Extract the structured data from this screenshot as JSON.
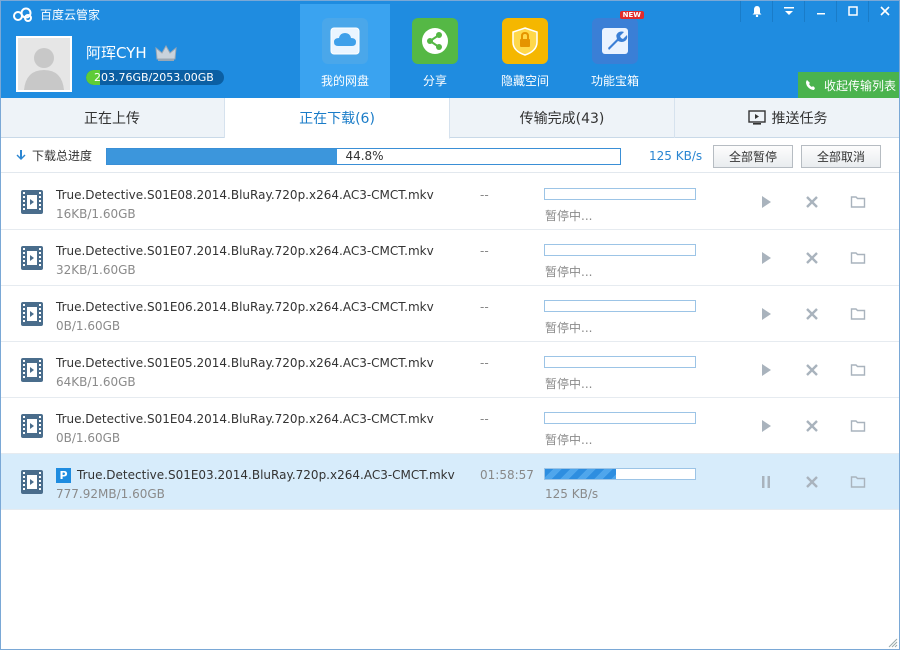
{
  "app": {
    "title": "百度云管家",
    "logo_icon": "baidu-cloud-logo-icon"
  },
  "user": {
    "name": "阿珲CYH",
    "quota": "203.76GB/2053.00GB",
    "quota_used_fraction": 0.0993,
    "avatar_icon": "default-avatar-icon",
    "vip_icon": "crown-icon"
  },
  "nav": [
    {
      "label": "我的网盘",
      "icon": "cloud-icon",
      "active": true
    },
    {
      "label": "分享",
      "icon": "share-icon",
      "active": false
    },
    {
      "label": "隐藏空间",
      "icon": "lock-icon",
      "active": false
    },
    {
      "label": "功能宝箱",
      "icon": "toolbox-icon",
      "active": false,
      "badge": "NEW"
    }
  ],
  "window_controls": [
    "bell-icon",
    "menu-icon",
    "minimize-icon",
    "maximize-icon",
    "close-icon"
  ],
  "collapse_label": "收起传输列表",
  "tabs": [
    {
      "label": "正在上传",
      "active": false
    },
    {
      "label": "正在下载(6)",
      "active": true
    },
    {
      "label": "传输完成(43)",
      "active": false
    },
    {
      "label": "推送任务",
      "active": false,
      "icon": "push-task-icon"
    }
  ],
  "total": {
    "label": "下载总进度",
    "percent_text": "44.8%",
    "percent": 44.8,
    "speed": "125 KB/s",
    "pause_all": "全部暂停",
    "cancel_all": "全部取消"
  },
  "downloads": [
    {
      "name": "True.Detective.S01E08.2014.BluRay.720p.x264.AC3-CMCT.mkv",
      "size": "16KB/1.60GB",
      "eta": "--",
      "status": "暂停中...",
      "progress": 0.0,
      "active": false
    },
    {
      "name": "True.Detective.S01E07.2014.BluRay.720p.x264.AC3-CMCT.mkv",
      "size": "32KB/1.60GB",
      "eta": "--",
      "status": "暂停中...",
      "progress": 0.0,
      "active": false
    },
    {
      "name": "True.Detective.S01E06.2014.BluRay.720p.x264.AC3-CMCT.mkv",
      "size": "0B/1.60GB",
      "eta": "--",
      "status": "暂停中...",
      "progress": 0.0,
      "active": false
    },
    {
      "name": "True.Detective.S01E05.2014.BluRay.720p.x264.AC3-CMCT.mkv",
      "size": "64KB/1.60GB",
      "eta": "--",
      "status": "暂停中...",
      "progress": 0.0,
      "active": false
    },
    {
      "name": "True.Detective.S01E04.2014.BluRay.720p.x264.AC3-CMCT.mkv",
      "size": "0B/1.60GB",
      "eta": "--",
      "status": "暂停中...",
      "progress": 0.0,
      "active": false
    },
    {
      "name": "True.Detective.S01E03.2014.BluRay.720p.x264.AC3-CMCT.mkv",
      "size": "777.92MB/1.60GB",
      "eta": "01:58:57",
      "status": "125 KB/s",
      "progress": 0.475,
      "active": true,
      "badge": "P"
    }
  ],
  "colors": {
    "header": "#1f8ce0",
    "accent": "#2b86d2",
    "collapse_green": "#4ab34e",
    "active_row": "#d7ecfb"
  }
}
